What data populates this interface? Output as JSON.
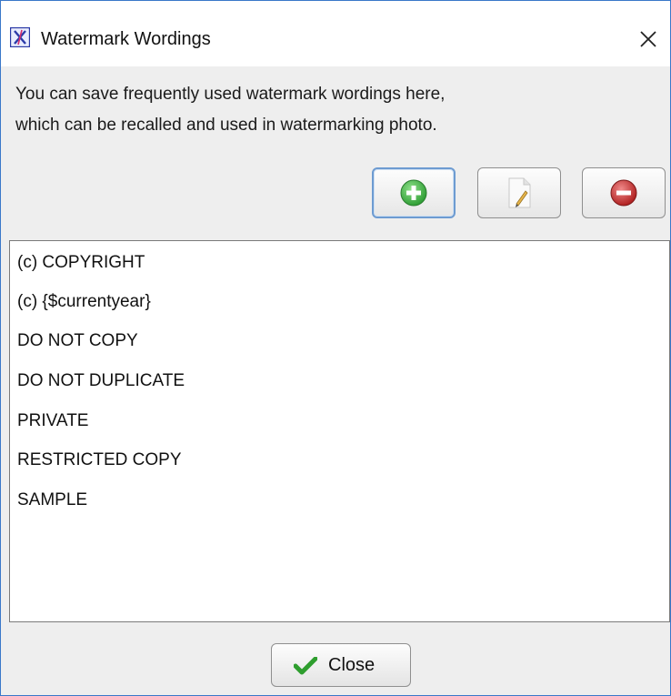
{
  "window": {
    "title": "Watermark Wordings",
    "app_icon": "app-logo-icon",
    "close_icon": "close-icon"
  },
  "description": {
    "line1": "You can save frequently used watermark wordings here,",
    "line2": "which can be recalled and used in watermarking photo."
  },
  "toolbar": {
    "buttons": [
      {
        "name": "add-button",
        "icon": "plus-circle-icon"
      },
      {
        "name": "edit-button",
        "icon": "document-edit-icon"
      },
      {
        "name": "remove-button",
        "icon": "minus-circle-icon"
      }
    ]
  },
  "wordings": {
    "items": [
      "(c) COPYRIGHT",
      "(c) {$currentyear}",
      "DO NOT COPY",
      "DO NOT DUPLICATE",
      "PRIVATE",
      "RESTRICTED COPY",
      "SAMPLE"
    ]
  },
  "footer": {
    "close_label": "Close",
    "close_icon": "checkmark-icon"
  },
  "colors": {
    "add_green": "#3cb043",
    "remove_red": "#c0392b",
    "check_green": "#2e9e2e",
    "window_border": "#3a78c9"
  }
}
